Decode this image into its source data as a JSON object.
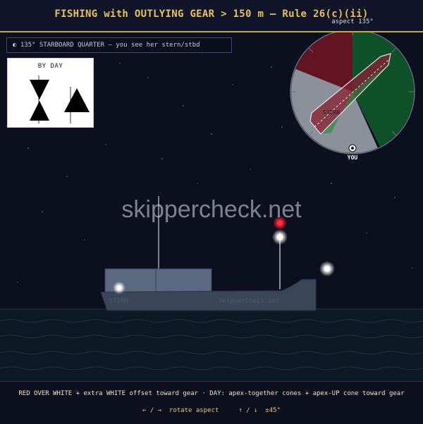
{
  "header": {
    "title": "FISHING with OUTLYING GEAR > 150 m — Rule 26(c)(ii)",
    "aspect_label": "aspect 135°"
  },
  "status": {
    "icon": "half-circle-icon",
    "text": "◐ 135°  STARBOARD QUARTER — you see her stern/stbd"
  },
  "day_panel": {
    "title": "BY DAY"
  },
  "radar": {
    "stern_label": "STERN",
    "you_label": "YOU",
    "sector_colors": {
      "port": "#6b1522",
      "starboard": "#0f5a2b",
      "stern": "#9aa0a6"
    }
  },
  "vessel": {
    "stern_label": "STERN",
    "name_label": "SkipperCheck.net"
  },
  "watermark": "skippercheck.net",
  "lights": {
    "masthead_red": "#ff3040",
    "white": "#ffffff"
  },
  "footer": {
    "description": "RED OVER WHITE + extra WHITE offset toward gear · DAY: apex-together cones + apex-UP cone toward gear",
    "rotate_hint": "← / →  rotate aspect",
    "step_hint": "↑ / ↓  ±45°"
  }
}
